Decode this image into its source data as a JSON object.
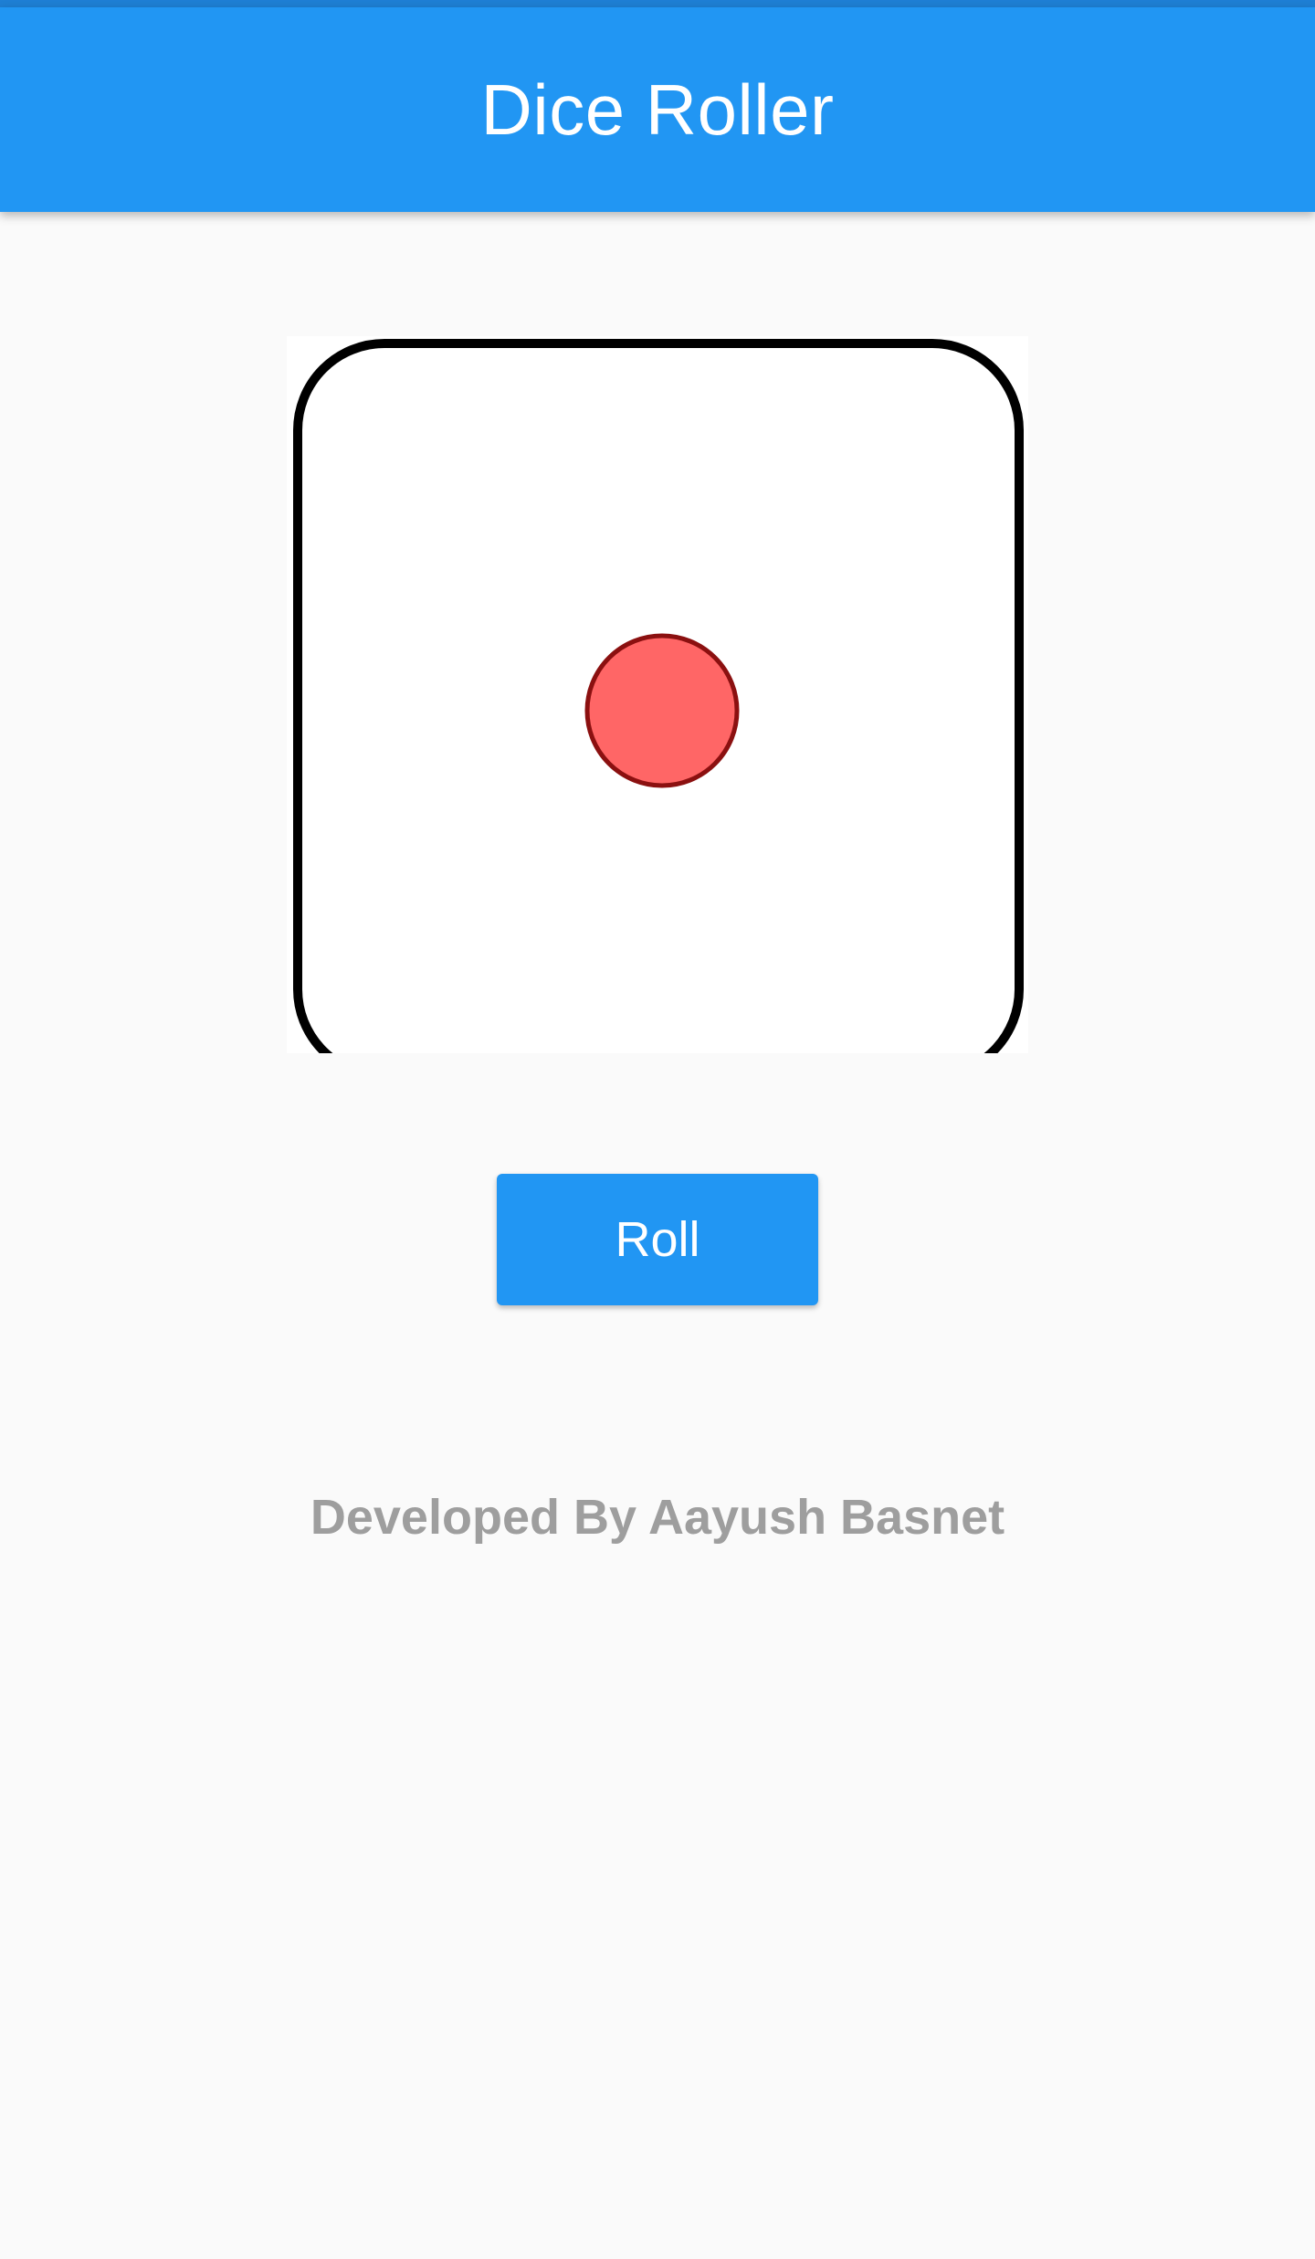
{
  "app_bar": {
    "title": "Dice Roller"
  },
  "dice": {
    "face_value": 1,
    "pip_color": "#ff6666",
    "pip_outline_color": "#8b1010",
    "border_color": "#000000"
  },
  "roll_button": {
    "label": "Roll"
  },
  "footer": {
    "credit": "Developed By Aayush Basnet"
  },
  "colors": {
    "primary": "#2196f3",
    "background": "#fafafa",
    "credit_text": "#9e9e9e"
  }
}
